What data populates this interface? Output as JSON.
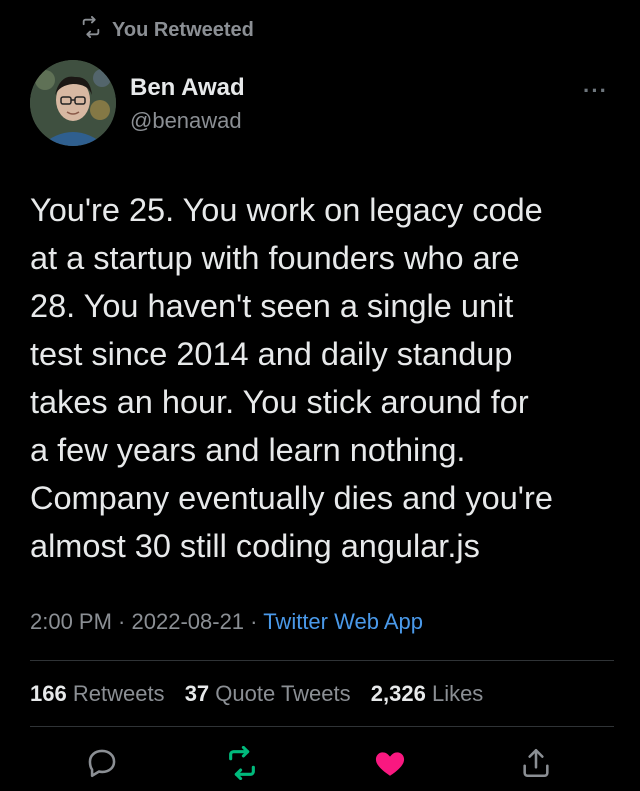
{
  "retweet": {
    "label": "You Retweeted",
    "icon": "retweet-icon"
  },
  "author": {
    "name": "Ben Awad",
    "handle": "@benawad"
  },
  "tweet": {
    "text_lines": [
      "You're 25. You work on legacy code",
      "at a startup with founders who are",
      "28. You haven't seen a single unit",
      "test since 2014 and daily standup",
      "takes an hour. You stick around for",
      "a few years and learn nothing.",
      "Company eventually dies and you're",
      "almost 30 still coding angular.js"
    ]
  },
  "meta": {
    "time": "2:00 PM",
    "sep1": " · ",
    "date": "2022-08-21",
    "sep2": " · ",
    "source": "Twitter Web App"
  },
  "stats": {
    "retweets_count": "166",
    "retweets_label": "Retweets",
    "quotes_count": "37",
    "quotes_label": "Quote Tweets",
    "likes_count": "2,326",
    "likes_label": "Likes"
  },
  "colors": {
    "background": "#000000",
    "text": "#e7e9ea",
    "muted": "#8b8f94",
    "link": "#4a99e9",
    "retweet_green": "#00ba7c",
    "like_pink": "#f91880"
  }
}
